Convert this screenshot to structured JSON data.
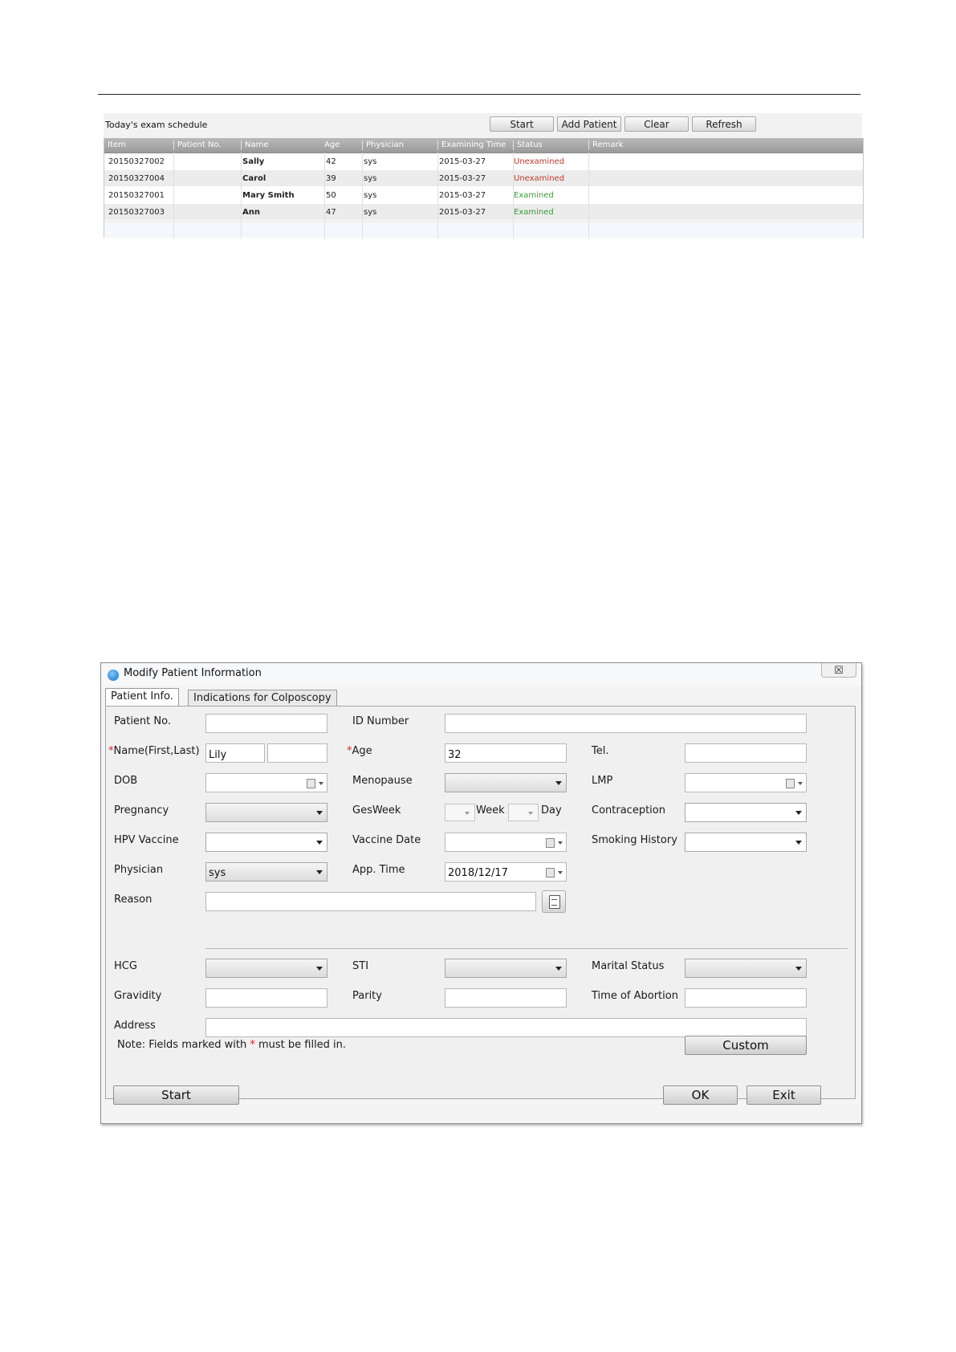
{
  "schedule": {
    "title": "Today's exam schedule",
    "buttons": {
      "start": "Start",
      "add_patient": "Add Patient",
      "clear": "Clear",
      "refresh": "Refresh"
    },
    "columns": [
      "Item",
      "Patient No.",
      "Name",
      "Age",
      "Physician",
      "Examining Time",
      "Status",
      "Remark"
    ],
    "rows": [
      {
        "item": "20150327002",
        "patient_no": "",
        "name": "Sally",
        "age": "42",
        "physician": "sys",
        "time": "2015-03-27",
        "status": "Unexamined",
        "remark": ""
      },
      {
        "item": "20150327004",
        "patient_no": "",
        "name": "Carol",
        "age": "39",
        "physician": "sys",
        "time": "2015-03-27",
        "status": "Unexamined",
        "remark": ""
      },
      {
        "item": "20150327001",
        "patient_no": "",
        "name": "Mary Smith",
        "age": "50",
        "physician": "sys",
        "time": "2015-03-27",
        "status": "Examined",
        "remark": ""
      },
      {
        "item": "20150327003",
        "patient_no": "",
        "name": "Ann",
        "age": "47",
        "physician": "sys",
        "time": "2015-03-27",
        "status": "Examined",
        "remark": ""
      }
    ],
    "status_colors": {
      "Unexamined": "#c0392b",
      "Examined": "#3a9a3a"
    }
  },
  "dialog": {
    "title": "Modify Patient Information",
    "close_symbol": "☒",
    "tabs": {
      "patient_info": "Patient Info.",
      "indications": "Indications for Colposcopy"
    },
    "labels": {
      "patient_no": "Patient No.",
      "id_number": "ID Number",
      "name": "Name(First,Last)",
      "age": "Age",
      "tel": "Tel.",
      "dob": "DOB",
      "menopause": "Menopause",
      "lmp": "LMP",
      "pregnancy": "Pregnancy",
      "gesweek": "GesWeek",
      "week": "Week",
      "day": "Day",
      "contraception": "Contraception",
      "hpv_vaccine": "HPV Vaccine",
      "vaccine_date": "Vaccine Date",
      "smoking_history": "Smoking History",
      "physician": "Physician",
      "app_time": "App. Time",
      "reason": "Reason",
      "hcg": "HCG",
      "sti": "STI",
      "marital_status": "Marital Status",
      "gravidity": "Gravidity",
      "parity": "Parity",
      "time_of_abortion": "Time of Abortion",
      "address": "Address"
    },
    "required_mark": "*",
    "values": {
      "patient_no": "",
      "id_number": "",
      "first_name": "Lily",
      "last_name": "",
      "age": "32",
      "tel": "",
      "physician": "sys",
      "app_time": "2018/12/17",
      "reason": "",
      "gravidity": "",
      "parity": "",
      "time_of_abortion": "",
      "address": ""
    },
    "note_prefix": "Note: Fields marked with ",
    "note_suffix": " must be filled in.",
    "buttons": {
      "custom": "Custom",
      "start": "Start",
      "ok": "OK",
      "exit": "Exit"
    }
  }
}
